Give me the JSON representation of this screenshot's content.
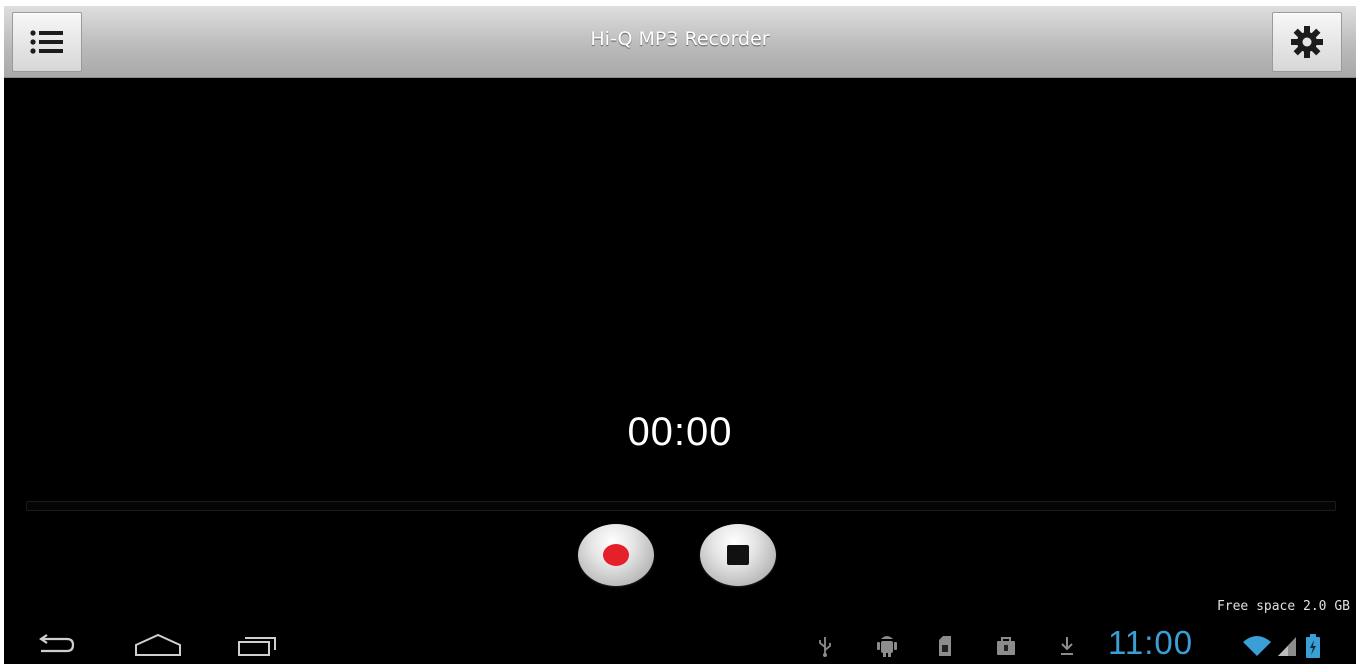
{
  "app": {
    "title": "Hi-Q MP3 Recorder",
    "menu_icon": "list-icon",
    "settings_icon": "gear-icon"
  },
  "recorder": {
    "timer": "00:00",
    "record_icon": "record-icon",
    "stop_icon": "stop-icon",
    "free_space": "Free space 2.0 GB"
  },
  "system_bar": {
    "nav": [
      "back-icon",
      "home-icon",
      "recent-apps-icon"
    ],
    "status_icons": [
      "usb-icon",
      "android-debug-icon",
      "sd-card-icon",
      "bag-icon",
      "download-icon"
    ],
    "clock": "11:00",
    "right_icons": [
      "wifi-icon",
      "signal-icon",
      "battery-icon"
    ]
  },
  "colors": {
    "background": "#000000",
    "action_bar": "#b9b9b9",
    "record_red": "#e4202a",
    "clock_blue": "#3a9fd6"
  }
}
